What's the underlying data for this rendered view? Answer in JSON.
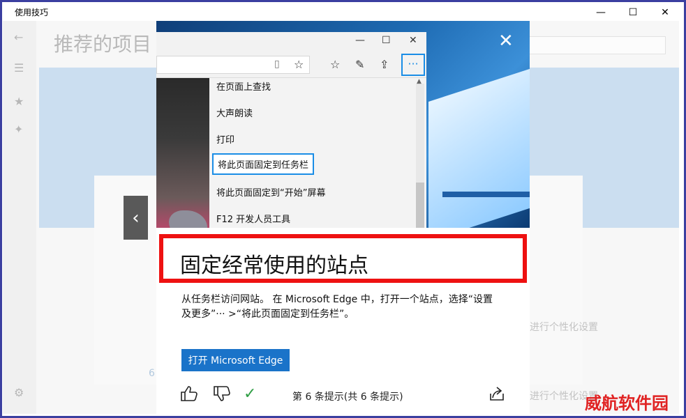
{
  "window": {
    "title": "使用技巧",
    "minimize_icon": "—",
    "maximize_icon": "☐",
    "close_icon": "✕"
  },
  "background": {
    "page_title": "推荐的项目",
    "text_personalize_1": "进行个性化设置",
    "text_personalize_2": "进行个性化设置",
    "side_number": "6"
  },
  "dialog": {
    "close_icon": "✕",
    "screenshot": {
      "minimize_icon": "—",
      "maximize_icon": "☐",
      "close_icon": "✕",
      "more_icon": "···",
      "menu_items": [
        "在页面上查找",
        "大声朗读",
        "打印",
        "将此页面固定到任务栏",
        "将此页面固定到“开始”屏幕",
        "F12 开发人员工具"
      ],
      "highlighted_index": 3
    },
    "tip": {
      "title": "固定经常使用的站点",
      "body_line1": "从任务栏访问网站。 在 Microsoft Edge 中，打开一个站点，选择“设置",
      "body_line2": "及更多”··· >“将此页面固定到任务栏”。",
      "open_button": "打开 Microsoft Edge"
    },
    "footer": {
      "counter": "第 6 条提示(共 6 条提示)",
      "like_icon": "👍",
      "dislike_icon": "👎",
      "check_icon": "✓",
      "share_icon": "⇪"
    }
  },
  "watermark": "威航软件园",
  "colors": {
    "accent": "#1a73c9",
    "highlight": "#ee1111",
    "frame": "#3b3fa0"
  }
}
